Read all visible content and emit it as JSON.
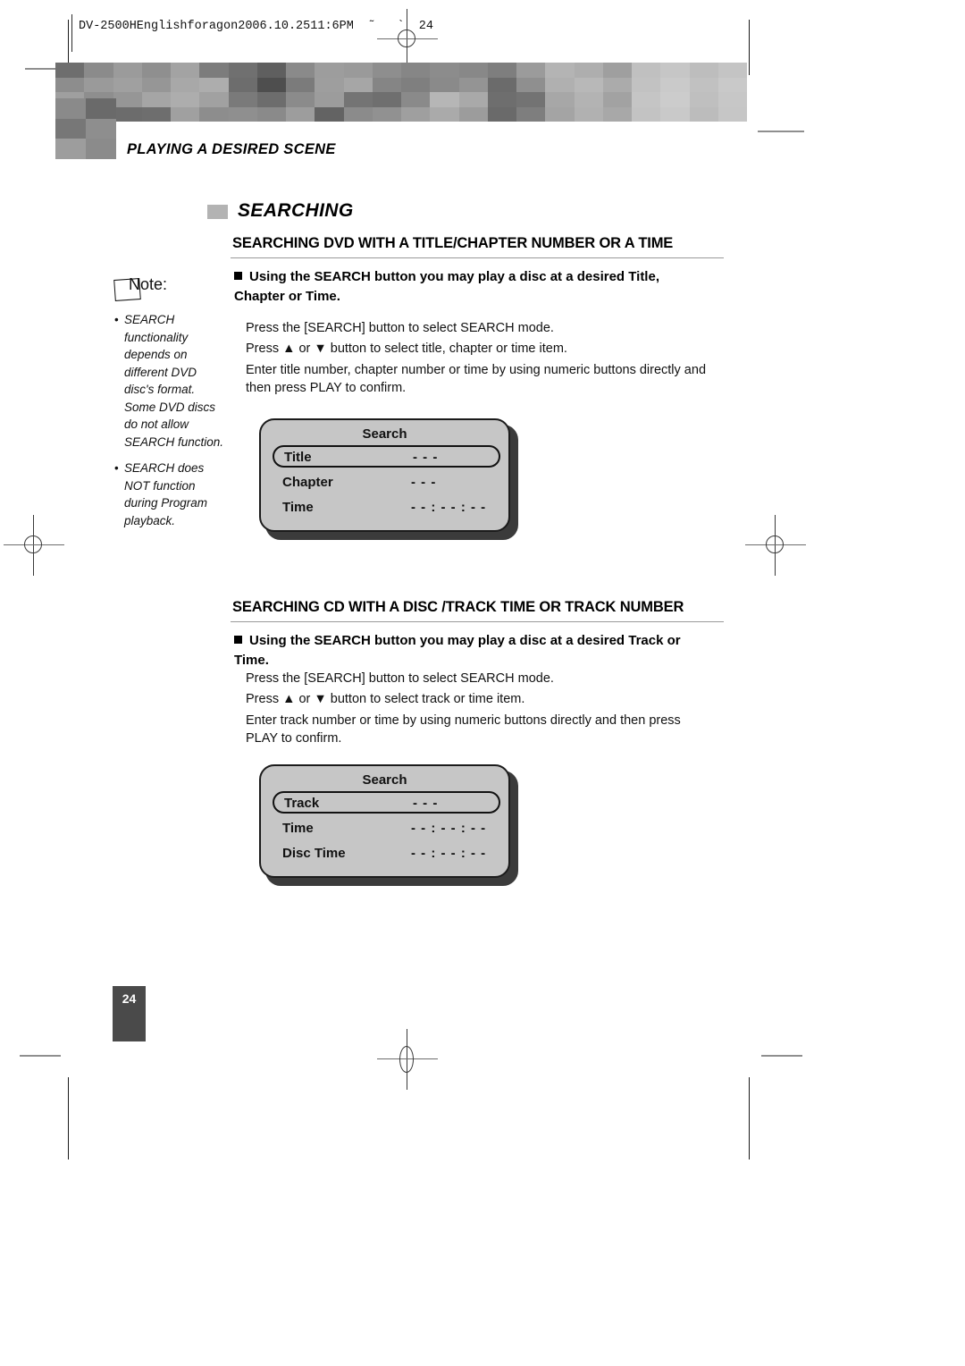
{
  "document": {
    "meta_line": "DV-2500HEnglishforagon2006.10.2511:6PM  ˜   `  24",
    "chapter_title": "PLAYING A DESIRED SCENE",
    "section_title": "SEARCHING",
    "page_number": "24"
  },
  "note": {
    "label": "Note:",
    "items": [
      "SEARCH functionality depends on different DVD disc's format. Some DVD discs do not allow SEARCH function.",
      "SEARCH does NOT function during Program playback."
    ]
  },
  "sections": [
    {
      "heading": "SEARCHING DVD WITH A TITLE/CHAPTER NUMBER OR A TIME",
      "bullet": "Using the SEARCH button you may play a disc at a desired Title, Chapter or Time.",
      "steps": [
        "Press the [SEARCH] button to select  SEARCH mode.",
        "Press ▲ or ▼ button to select title, chapter or time item.",
        "Enter title number, chapter number or time by using numeric buttons directly  and then press PLAY to confirm."
      ],
      "osd": {
        "title": "Search",
        "rows": [
          {
            "label": "Title",
            "value": "- - -",
            "selected": true
          },
          {
            "label": "Chapter",
            "value": "- - -",
            "selected": false
          },
          {
            "label": "Time",
            "value": "- - : - - : - -",
            "selected": false
          }
        ]
      }
    },
    {
      "heading": "SEARCHING CD WITH A DISC /TRACK TIME OR TRACK NUMBER",
      "bullet": "Using the SEARCH button you may play a disc at a desired Track or Time.",
      "steps": [
        "Press the [SEARCH] button to select  SEARCH mode.",
        "Press ▲ or ▼ button to select track or time item.",
        "Enter track number or time by using numeric buttons directly and then press PLAY to confirm."
      ],
      "osd": {
        "title": "Search",
        "rows": [
          {
            "label": "Track",
            "value": "- - -",
            "selected": true
          },
          {
            "label": "Time",
            "value": "- - : - - : - -",
            "selected": false
          },
          {
            "label": "Disc Time",
            "value": "- - : - - : - -",
            "selected": false
          }
        ]
      }
    }
  ],
  "colors": {
    "osd_panel": "#c6c6c6",
    "section_bullet": "#b3b3b3",
    "page_number_bg": "#4a4a4a"
  }
}
